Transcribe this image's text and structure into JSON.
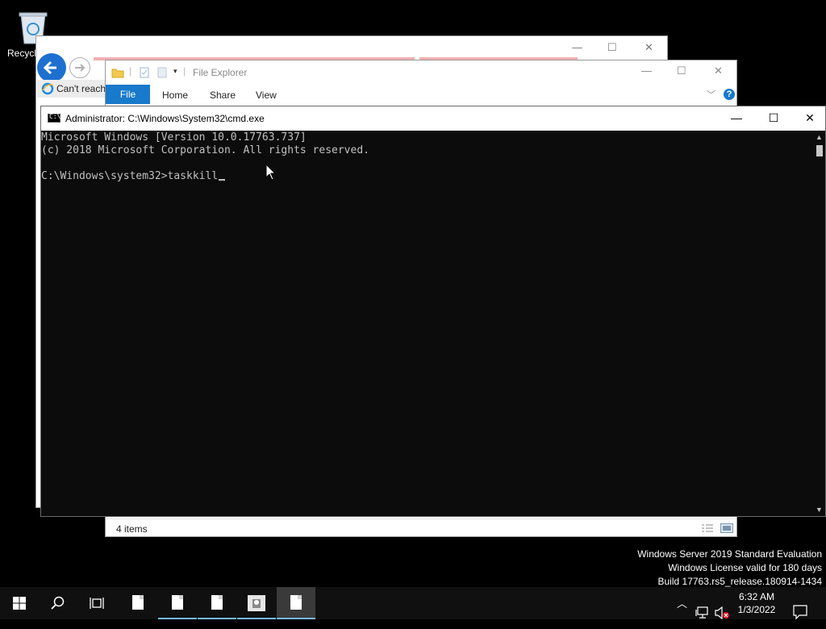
{
  "desktop": {
    "recycle_bin_label": "Recycl"
  },
  "ie_window": {
    "tab_title": "Can't reach",
    "minimize": "—",
    "maximize": "☐",
    "close": "✕"
  },
  "file_explorer": {
    "title": "File Explorer",
    "ribbon_tabs": [
      "File",
      "Home",
      "Share",
      "View"
    ],
    "status_items": "4 items",
    "help": "?",
    "minimize": "—",
    "maximize": "☐",
    "close": "✕"
  },
  "cmd_window": {
    "title": "Administrator: C:\\Windows\\System32\\cmd.exe",
    "minimize": "—",
    "maximize": "☐",
    "close": "✕",
    "lines": [
      "Microsoft Windows [Version 10.0.17763.737]",
      "(c) 2018 Microsoft Corporation. All rights reserved.",
      "",
      "C:\\Windows\\system32>taskkill"
    ]
  },
  "watermark": {
    "line1": "Windows Server 2019 Standard Evaluation",
    "line2": "Windows License valid for 180 days",
    "line3": "Build 17763.rs5_release.180914-1434"
  },
  "taskbar": {
    "time": "6:32 AM",
    "date": "1/3/2022",
    "accent_color": "#76b9ed"
  }
}
